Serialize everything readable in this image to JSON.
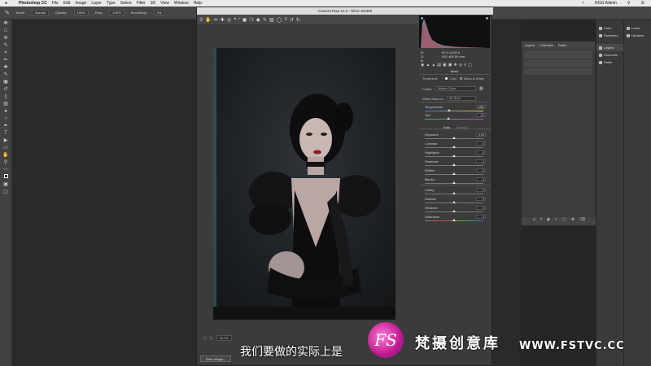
{
  "menubar": {
    "app": "Photoshop CC",
    "items": [
      "File",
      "Edit",
      "Image",
      "Layer",
      "Type",
      "Select",
      "Filter",
      "3D",
      "View",
      "Window",
      "Help"
    ],
    "right_user": "RGG Admin"
  },
  "options": {
    "mode_label": "Mode:",
    "mode_value": "Normal",
    "opacity_label": "Opacity:",
    "opacity_value": "100%",
    "flow_label": "Flow:",
    "flow_value": "100%",
    "smoothing_label": "Smoothing:",
    "smoothing_value": "0%"
  },
  "dialog": {
    "title": "Camera Raw 10.3  -  Nikon D5300",
    "camera_info": [
      "f/2.0  1/200 s",
      "ISO 400   50 mm"
    ],
    "rgb": [
      "R:",
      "G:",
      "B:"
    ],
    "panel_title": "Basic",
    "treatment_label": "Treatment:",
    "treatment_color": "Color",
    "treatment_bw": "Black & White",
    "profile_label": "Profile:",
    "profile_value": "Adobe Color",
    "wb_label": "White Balance:",
    "wb_value": "As Shot",
    "auto": "Auto",
    "default": "Default",
    "zoom": "15.7%",
    "save_button": "Save Image..."
  },
  "sliders": [
    {
      "label": "Temperature",
      "value": "4450",
      "pos": 0.42
    },
    {
      "label": "Tint",
      "value": "-27",
      "pos": 0.4
    },
    {
      "label": "Exposure",
      "value": "0.00",
      "pos": 0.5
    },
    {
      "label": "Contrast",
      "value": "0",
      "pos": 0.5
    },
    {
      "label": "Highlights",
      "value": "0",
      "pos": 0.5
    },
    {
      "label": "Shadows",
      "value": "0",
      "pos": 0.5
    },
    {
      "label": "Whites",
      "value": "0",
      "pos": 0.5
    },
    {
      "label": "Blacks",
      "value": "0",
      "pos": 0.5
    },
    {
      "label": "Clarity",
      "value": "0",
      "pos": 0.5
    },
    {
      "label": "Dehaze",
      "value": "0",
      "pos": 0.5
    },
    {
      "label": "Vibrance",
      "value": "0",
      "pos": 0.5
    },
    {
      "label": "Saturation",
      "value": "0",
      "pos": 0.5
    }
  ],
  "layers_panel": {
    "tabs": [
      "Layers",
      "Channels",
      "Paths"
    ]
  },
  "dock1": [
    "Color",
    "Swatches",
    "Layers",
    "Channels",
    "Paths"
  ],
  "dock2": [
    "Learn",
    "Libraries"
  ],
  "subtitle": "我们要做的实际上是",
  "watermark": {
    "logo": "FS",
    "name": "梵摄创意库",
    "url": "WWW.FSTVC.CC"
  },
  "colors": {
    "accent": "#c01a8f",
    "panel": "#3b3b3b"
  }
}
